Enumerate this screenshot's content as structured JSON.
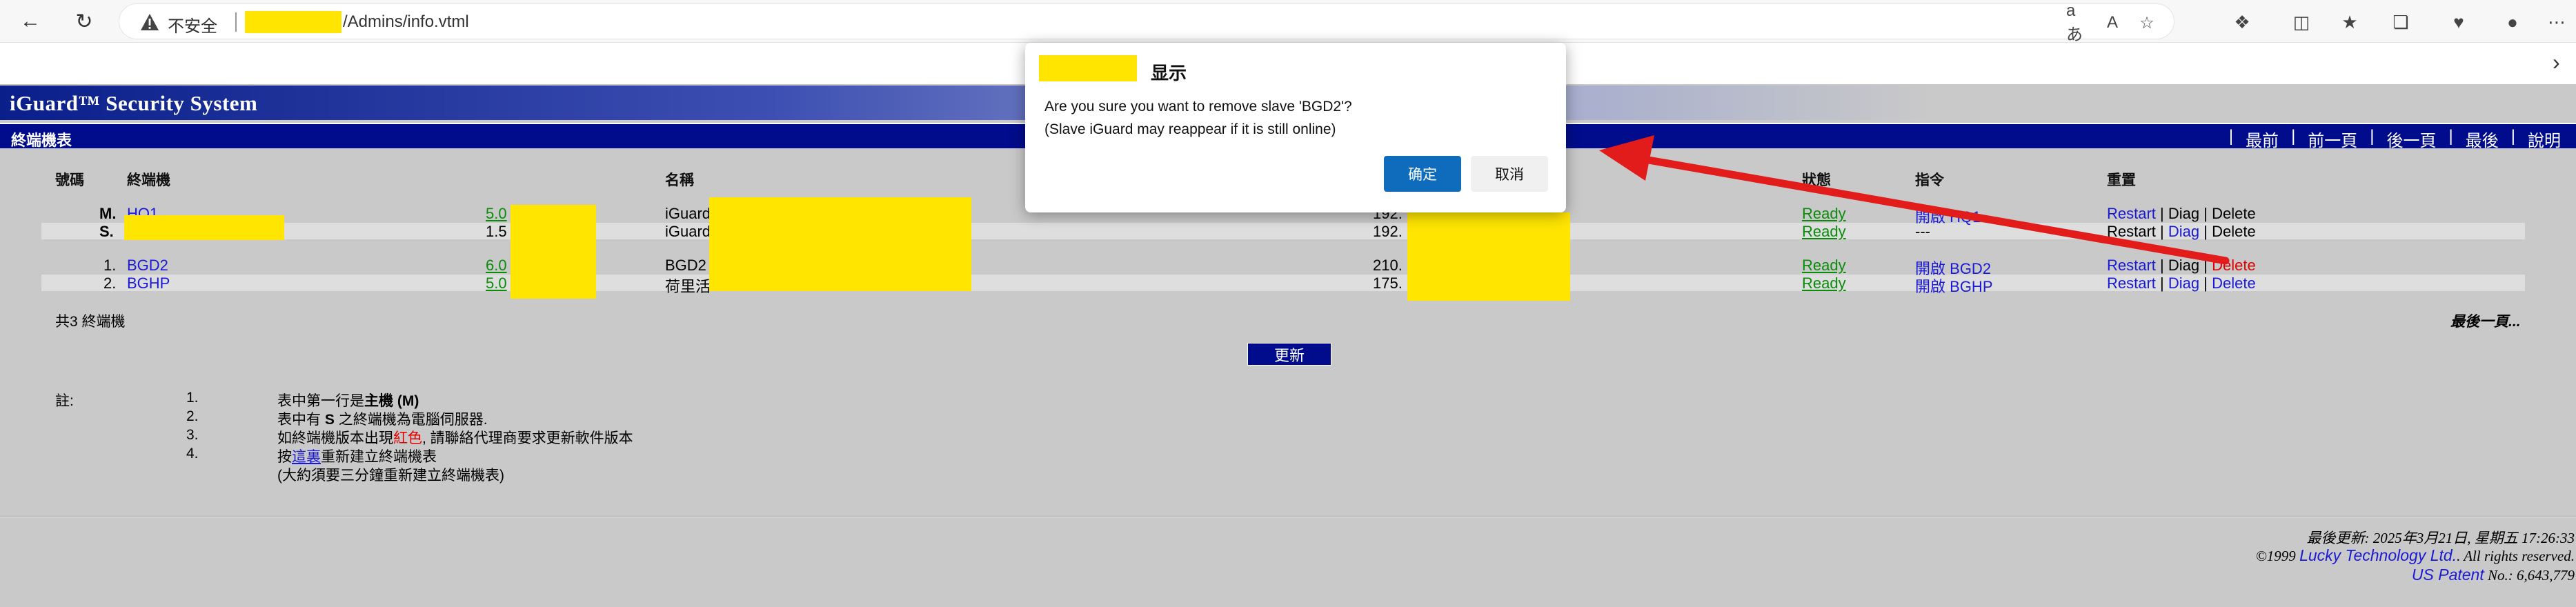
{
  "browser": {
    "insecure_label": "不安全",
    "url_path": "/Admins/info.vtml",
    "icons": [
      "back-icon",
      "reload-icon",
      "warning-icon",
      "read-aloud-icon",
      "text-size-icon",
      "favorite-star-icon",
      "extensions-icon",
      "split-screen-icon",
      "favorites-icon",
      "collections-icon",
      "browser-essentials-icon",
      "profile-icon",
      "more-icon"
    ]
  },
  "app": {
    "title": "iGuard™ Security System",
    "section_title": "終端機表",
    "nav": [
      "最前",
      "前一頁",
      "後一頁",
      "最後",
      "說明"
    ]
  },
  "table": {
    "headers": {
      "num": "號碼",
      "terminal": "終端機",
      "name": "名稱",
      "status": "狀態",
      "command": "指令",
      "reset": "重置"
    },
    "rows": [
      {
        "num": "M.",
        "terminal": "HQ1",
        "version": "5.0",
        "name": "iGuard",
        "ip": "192.",
        "status": "Ready",
        "cmd_prefix": "開啟",
        "cmd_target": "HQ1",
        "restart": "Restart",
        "diag": "Diag",
        "delete": "Delete"
      },
      {
        "num": "S.",
        "terminal": "",
        "version": "1.5",
        "name": "iGuard",
        "ip": "192.",
        "status": "Ready",
        "cmd_prefix": "---",
        "cmd_target": "",
        "restart": "Restart",
        "diag": "Diag",
        "delete": "Delete"
      },
      {
        "num": "1.",
        "terminal": "BGD2",
        "version": "6.0",
        "name": "BGD2",
        "ip": "210.",
        "status": "Ready",
        "cmd_prefix": "開啟",
        "cmd_target": "BGD2",
        "restart": "Restart",
        "diag": "Diag",
        "delete": "Delete"
      },
      {
        "num": "2.",
        "terminal": "BGHP",
        "version": "5.0",
        "name": "荷里活",
        "ip": "175.",
        "status": "Ready",
        "cmd_prefix": "開啟",
        "cmd_target": "BGHP",
        "restart": "Restart",
        "diag": "Diag",
        "delete": "Delete"
      }
    ],
    "separator": "|",
    "count_text": "共3 終端機",
    "last_page_text": "最後一頁..."
  },
  "update_button": "更新",
  "notes": {
    "label": "註:",
    "items": [
      {
        "num": "1.",
        "pre": "表中第一行是",
        "bold": "主機 (M)",
        "post": ""
      },
      {
        "num": "2.",
        "pre": "表中有 ",
        "bold": "S",
        "post": " 之終端機為電腦伺服器."
      },
      {
        "num": "3.",
        "pre": "如終端機版本出現",
        "red": "紅色",
        "post": ", 請聯絡代理商要求更新軟件版本"
      },
      {
        "num": "4.",
        "pre": "按",
        "link": "這裏",
        "post": "重新建立終端機表"
      }
    ],
    "extra": "(大約須要三分鐘重新建立終端機表)"
  },
  "footer": {
    "last_update": "最後更新: 2025年3月21日, 星期五 17:26:33",
    "copyright_prefix": "©1999 ",
    "company": "Lucky Technology Ltd.",
    "rights": ". All rights reserved.",
    "patent_link": "US Patent",
    "patent_no": " No.: 6,643,779"
  },
  "dialog": {
    "title": "显示",
    "message_line1": "Are you sure you want to remove slave 'BGD2'?",
    "message_line2": "(Slave iGuard may reappear if it is still online)",
    "ok": "确定",
    "cancel": "取消"
  },
  "colors": {
    "section_bar": "#000c8c",
    "link": "#1a1ad4",
    "ready": "#0a8c0a",
    "delete_highlight": "#e00000",
    "redaction": "#ffe500",
    "dialog_primary": "#0f6cbd",
    "annotation_arrow": "#e21b1b"
  }
}
